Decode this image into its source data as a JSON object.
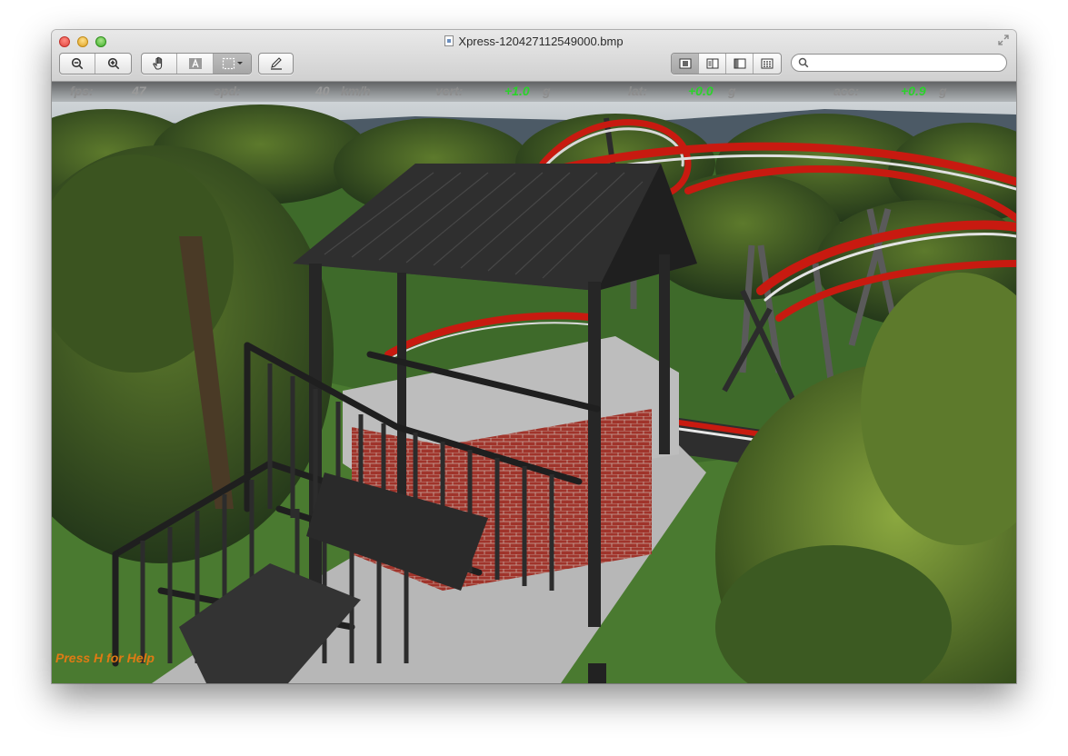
{
  "window": {
    "title": "Xpress-120427112549000.bmp"
  },
  "toolbar": {
    "zoom_out_icon": "zoom-out-icon",
    "zoom_in_icon": "zoom-in-icon",
    "hand_icon": "hand-tool-icon",
    "text_icon": "text-select-icon",
    "select_icon": "rect-select-icon",
    "annotate_icon": "pencil-icon",
    "view_buttons": [
      "single-page-icon",
      "two-page-icon",
      "sidebar-icon",
      "contact-sheet-icon"
    ],
    "search_placeholder": ""
  },
  "hud": {
    "fps_label": "fps:",
    "fps_value": "47",
    "spd_label": "spd:",
    "spd_value": "40",
    "spd_unit": "km/h",
    "vert_label": "vert:",
    "vert_value": "+1.0",
    "vert_unit": "g",
    "lat_label": "lat:",
    "lat_value": "+0.0",
    "lat_unit": "g",
    "acc_label": "acc:",
    "acc_value": "+0.9",
    "acc_unit": "g"
  },
  "help_text": "Press H for Help",
  "colors": {
    "hud_green": "#2bd22b",
    "help_orange": "#e07a14",
    "track_red": "#c81a10",
    "structure_dark": "#2b2b2b"
  }
}
